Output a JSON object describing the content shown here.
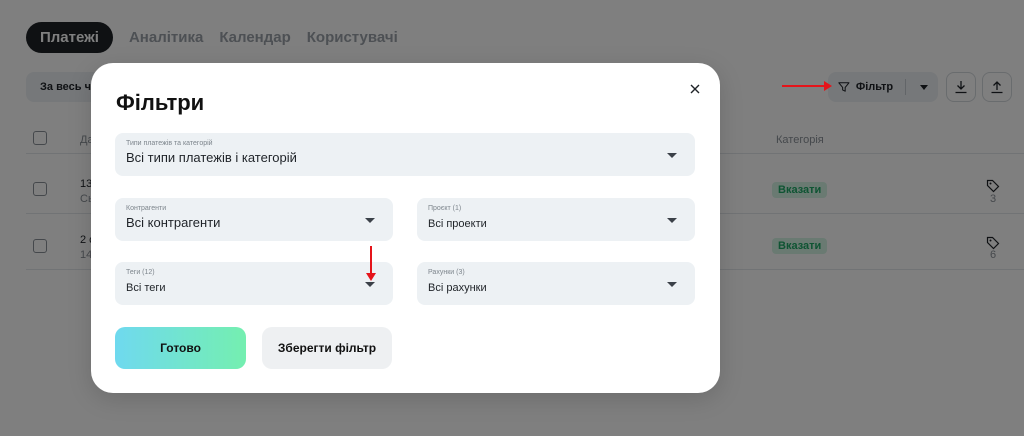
{
  "background": {
    "tabs": [
      "Платежі",
      "Аналітика",
      "Календар",
      "Користувачі"
    ],
    "period_label": "За весь час",
    "filter_button_label": "Фільтр",
    "table": {
      "header_date_label": "Да",
      "header_category_label": "Категорія",
      "rows": [
        {
          "date": "13",
          "sub": "Сь",
          "category_badge": "Вказати",
          "tags_count": "3"
        },
        {
          "date": "2 с",
          "sub": "14",
          "category_badge": "Вказати",
          "tags_count": "6"
        }
      ]
    }
  },
  "modal": {
    "title": "Фільтри",
    "fields": {
      "payment_types": {
        "label": "Типи платежів та категорій",
        "value": "Всі типи платежів і категорій"
      },
      "counterparties": {
        "label": "Контрагенти",
        "value": "Всі контрагенти"
      },
      "project": {
        "label": "Проєкт (1)",
        "value": "Всі проекти"
      },
      "tags": {
        "label": "Теги (12)",
        "value": "Всі теги"
      },
      "accounts": {
        "label": "Рахунки (3)",
        "value": "Всі рахунки"
      }
    },
    "done_button": "Готово",
    "save_filter_button": "Зберегти фільтр"
  },
  "annotation_color": "#e5141a"
}
